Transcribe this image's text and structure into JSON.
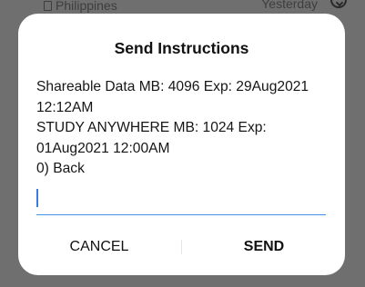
{
  "background": {
    "subtitle": "Philippines",
    "time": "Yesterday",
    "icon": "chevron-circle-icon"
  },
  "dialog": {
    "title": "Send Instructions",
    "lines": [
      "Shareable Data MB: 4096 Exp: 29Aug2021",
      "12:12AM",
      "STUDY ANYWHERE MB: 1024 Exp:",
      "01Aug2021 12:00AM",
      "0) Back"
    ],
    "input_value": "",
    "cancel_label": "CANCEL",
    "send_label": "SEND"
  },
  "colors": {
    "scrim": "#6f6f6f",
    "dialog_bg": "#ffffff",
    "accent": "#4a90e2"
  }
}
